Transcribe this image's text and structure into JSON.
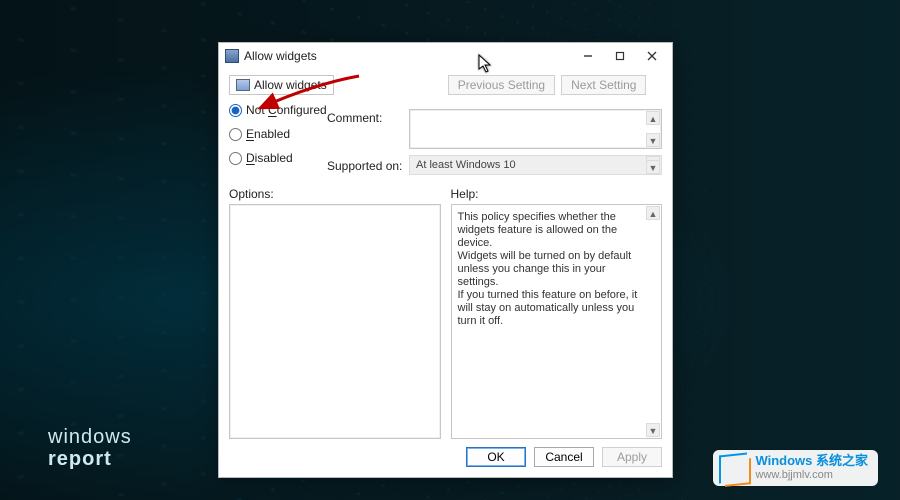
{
  "background": {
    "watermark_left_line1": "windows",
    "watermark_left_line2": "report",
    "watermark_right_title": "Windows 系统之家",
    "watermark_right_url": "www.bjjmlv.com"
  },
  "window": {
    "title": "Allow widgets",
    "breadcrumb": "Allow widgets",
    "nav": {
      "previous": "Previous Setting",
      "next": "Next Setting"
    },
    "radios": {
      "not_configured": "Not Configured",
      "enabled": "Enabled",
      "disabled": "Disabled",
      "selected": "not_configured"
    },
    "labels": {
      "comment": "Comment:",
      "supported_on": "Supported on:",
      "options": "Options:",
      "help": "Help:"
    },
    "supported_text": "At least Windows 10",
    "help_text": "This policy specifies whether the widgets feature is allowed on the device.\nWidgets will be turned on by default unless you change this in your settings.\nIf you turned this feature on before, it will stay on automatically unless you turn it off.",
    "buttons": {
      "ok": "OK",
      "cancel": "Cancel",
      "apply": "Apply"
    }
  }
}
